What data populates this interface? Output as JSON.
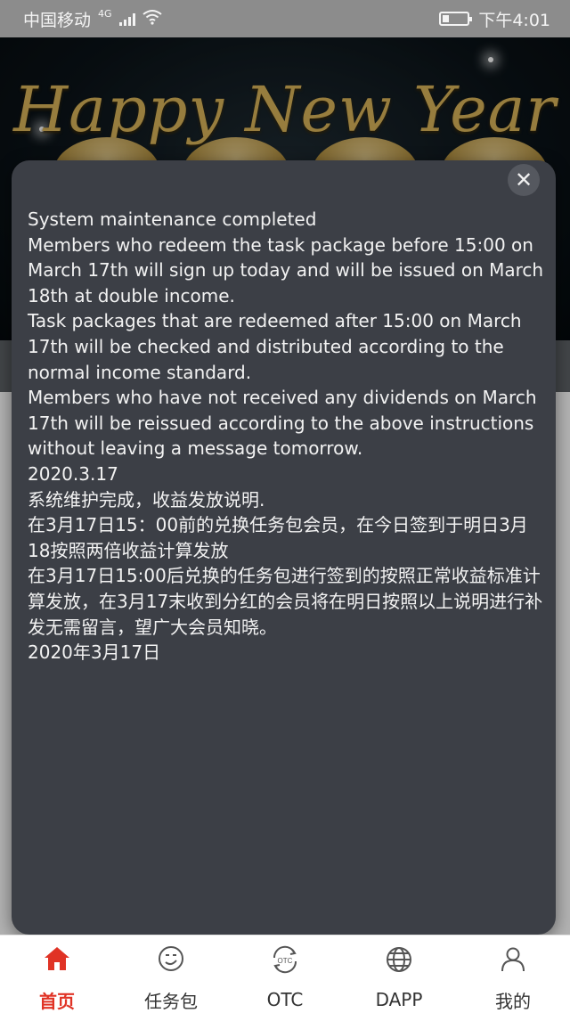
{
  "status_bar": {
    "carrier": "中国移动",
    "network": "4G",
    "time": "下午4:01"
  },
  "banner": {
    "title": "Happy New Year"
  },
  "notice": {
    "lines": [
      "System maintenance completed",
      "Members who redeem the task package before 15:00 on March 17th will sign up today and will be issued on March 18th at double income.",
      "Task packages that are redeemed after 15:00 on March 17th will be checked and distributed according to the normal income standard.",
      "Members who have not received any dividends on March 17th will be reissued according to the above instructions without leaving a message tomorrow.",
      "2020.3.17",
      "系统维护完成，收益发放说明.",
      "在3月17日15：00前的兑换任务包会员，在今日签到于明日3月18按照两倍收益计算发放",
      "在3月17日15:00后兑换的任务包进行签到的按照正常收益标准计算发放，在3月17末收到分红的会员将在明日按照以上说明进行补发无需留言，望广大会员知晓。",
      "2020年3月17日"
    ]
  },
  "tabs": [
    {
      "label": "首页",
      "icon": "home-icon",
      "active": true
    },
    {
      "label": "任务包",
      "icon": "task-package-icon",
      "active": false
    },
    {
      "label": "OTC",
      "icon": "otc-icon",
      "active": false
    },
    {
      "label": "DAPP",
      "icon": "globe-icon",
      "active": false
    },
    {
      "label": "我的",
      "icon": "user-icon",
      "active": false
    }
  ],
  "colors": {
    "accent": "#e03325",
    "modal_bg": "#3c3f46",
    "tab_inactive": "#333333"
  }
}
